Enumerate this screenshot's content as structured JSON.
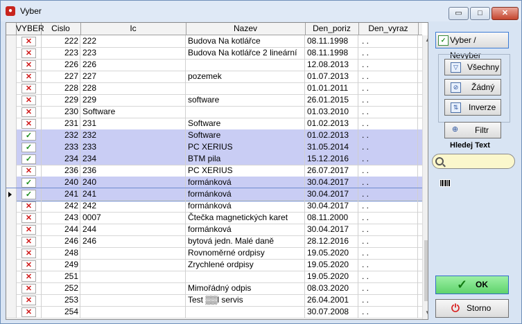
{
  "window": {
    "title": "Vyber",
    "minimize_glyph": "▭",
    "maximize_glyph": "□",
    "close_glyph": "✕"
  },
  "grid": {
    "columns": [
      "VYBER",
      "Cislo",
      "Ic",
      "Nazev",
      "Den_poriz",
      "Den_vyraz"
    ],
    "rows": [
      {
        "selected": false,
        "cislo": "222",
        "ic": "222",
        "nazev": "Budova Na kotlářce",
        "den_poriz": "08.11.1998",
        "den_vyraz": ". ."
      },
      {
        "selected": false,
        "cislo": "223",
        "ic": "223",
        "nazev": "Budova Na kotlářce 2 lineární",
        "den_poriz": "08.11.1998",
        "den_vyraz": ". ."
      },
      {
        "selected": false,
        "cislo": "226",
        "ic": "226",
        "nazev": "",
        "den_poriz": "12.08.2013",
        "den_vyraz": ". ."
      },
      {
        "selected": false,
        "cislo": "227",
        "ic": "227",
        "nazev": "pozemek",
        "den_poriz": "01.07.2013",
        "den_vyraz": ". ."
      },
      {
        "selected": false,
        "cislo": "228",
        "ic": "228",
        "nazev": "",
        "den_poriz": "01.01.2011",
        "den_vyraz": ". ."
      },
      {
        "selected": false,
        "cislo": "229",
        "ic": "229",
        "nazev": "software",
        "den_poriz": "26.01.2015",
        "den_vyraz": ". ."
      },
      {
        "selected": false,
        "cislo": "230",
        "ic": "Software",
        "nazev": "",
        "den_poriz": "01.03.2010",
        "den_vyraz": ". ."
      },
      {
        "selected": false,
        "cislo": "231",
        "ic": "231",
        "nazev": "Software",
        "den_poriz": "01.02.2013",
        "den_vyraz": ". ."
      },
      {
        "selected": true,
        "cislo": "232",
        "ic": "232",
        "nazev": "Software",
        "den_poriz": "01.02.2013",
        "den_vyraz": ". ."
      },
      {
        "selected": true,
        "cislo": "233",
        "ic": "233",
        "nazev": "PC XERIUS",
        "den_poriz": "31.05.2014",
        "den_vyraz": ". ."
      },
      {
        "selected": true,
        "cislo": "234",
        "ic": "234",
        "nazev": "BTM pila",
        "den_poriz": "15.12.2016",
        "den_vyraz": ". ."
      },
      {
        "selected": false,
        "cislo": "236",
        "ic": "236",
        "nazev": "PC XERIUS",
        "den_poriz": "26.07.2017",
        "den_vyraz": ". ."
      },
      {
        "selected": true,
        "cislo": "240",
        "ic": "240",
        "nazev": " formánková",
        "den_poriz": "30.04.2017",
        "den_vyraz": ". ."
      },
      {
        "selected": true,
        "current": true,
        "cislo": "241",
        "ic": "241",
        "nazev": " formánková",
        "den_poriz": "30.04.2017",
        "den_vyraz": ". ."
      },
      {
        "selected": false,
        "cislo": "242",
        "ic": "242",
        "nazev": " formánková",
        "den_poriz": "30.04.2017",
        "den_vyraz": ". ."
      },
      {
        "selected": false,
        "cislo": "243",
        "ic": "0007",
        "nazev": "Čtečka magnetických karet",
        "den_poriz": "08.11.2000",
        "den_vyraz": ". ."
      },
      {
        "selected": false,
        "cislo": "244",
        "ic": "244",
        "nazev": " formánková",
        "den_poriz": "30.04.2017",
        "den_vyraz": ". ."
      },
      {
        "selected": false,
        "cislo": "246",
        "ic": "246",
        "nazev": "bytová jedn. Malé daně",
        "den_poriz": "28.12.2016",
        "den_vyraz": ". ."
      },
      {
        "selected": false,
        "cislo": "248",
        "ic": "",
        "nazev": "Rovnoměrné ordpisy",
        "den_poriz": "19.05.2020",
        "den_vyraz": ". ."
      },
      {
        "selected": false,
        "cislo": "249",
        "ic": "",
        "nazev": "Zrychlené ordpisy",
        "den_poriz": "19.05.2020",
        "den_vyraz": ". ."
      },
      {
        "selected": false,
        "cislo": "251",
        "ic": "",
        "nazev": "",
        "den_poriz": "19.05.2020",
        "den_vyraz": ". ."
      },
      {
        "selected": false,
        "cislo": "252",
        "ic": "",
        "nazev": "Mimořádný odpis",
        "den_poriz": "08.03.2020",
        "den_vyraz": ". ."
      },
      {
        "selected": false,
        "cislo": "253",
        "ic": "",
        "nazev": "Test ▒▒l servis",
        "den_poriz": "26.04.2001",
        "den_vyraz": ". ."
      },
      {
        "selected": false,
        "cislo": "254",
        "ic": "",
        "nazev": "",
        "den_poriz": "30.07.2008",
        "den_vyraz": ". ."
      }
    ],
    "check_glyph": "✓",
    "cross_glyph": "✕"
  },
  "sidebar": {
    "toggle_label": "Vyber / Nevyber",
    "all_label": "Všechny",
    "none_label": "Žádný",
    "invert_label": "Inverze",
    "filter_label": "Filtr",
    "search_label": "Hledej Text",
    "search_value": "",
    "barcode_icon": "barcode-icon",
    "ok_label": "OK",
    "cancel_label": "Storno"
  },
  "colors": {
    "selected_row": "#c9cdf4",
    "ok_button": "#6fdc7a",
    "search_bg": "#fbf7cc",
    "cancel_icon": "#d82020"
  }
}
